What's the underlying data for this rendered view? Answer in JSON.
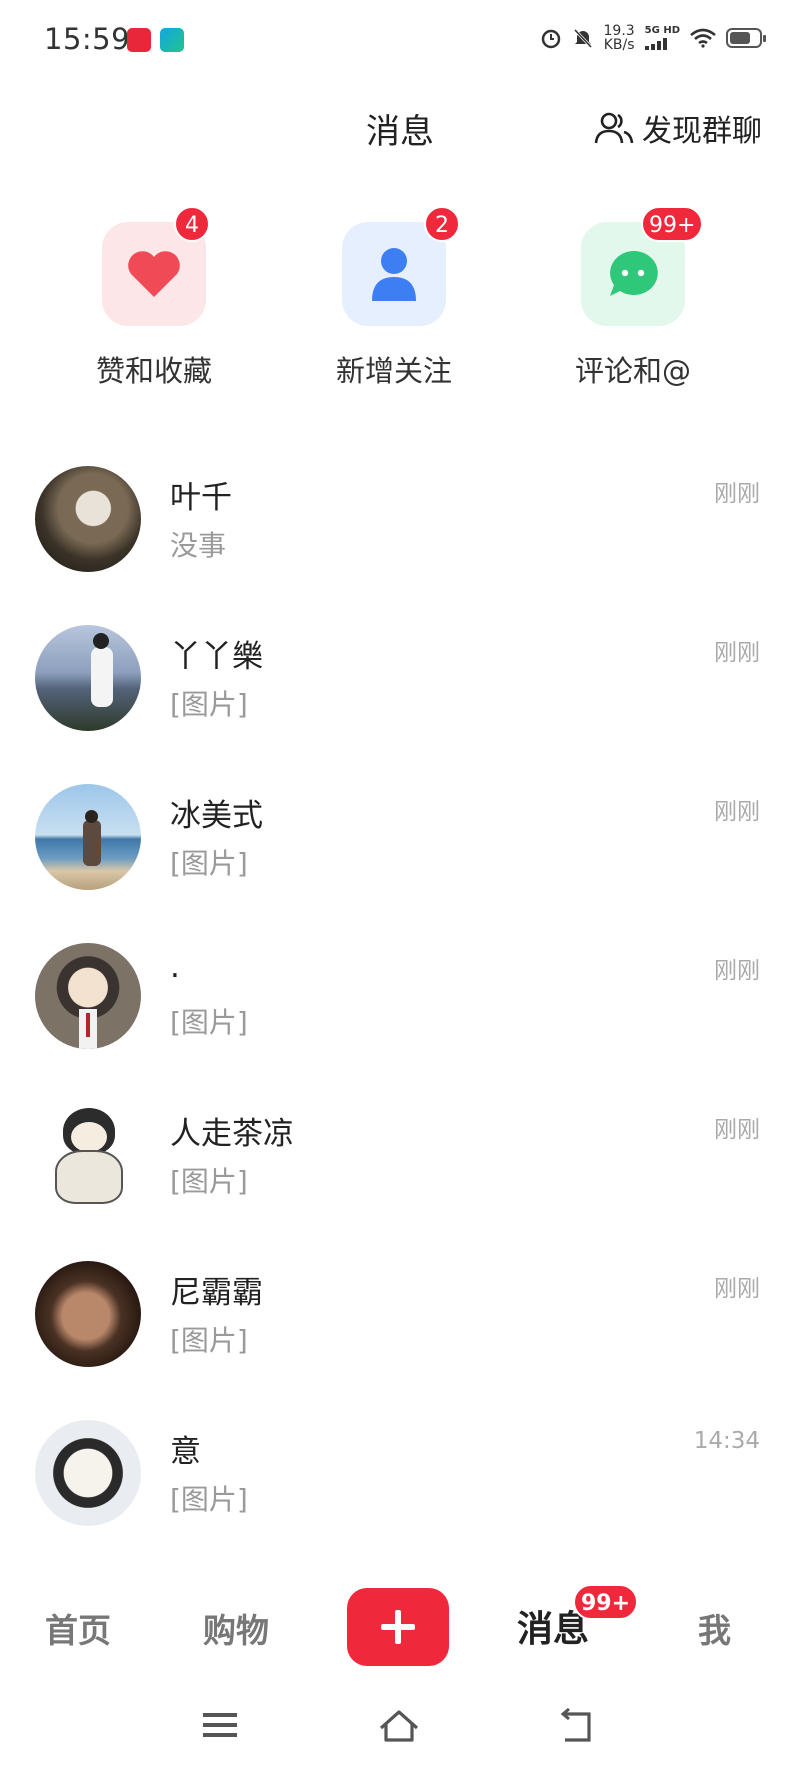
{
  "status_bar": {
    "time": "15:59",
    "net_speed_value": "19.3",
    "net_speed_unit": "KB/s",
    "signal_label": "5G HD",
    "battery_level": 0.7,
    "icons": [
      "xiaohongshu-app-icon",
      "wifi-hotspot-app-icon",
      "alarm-icon",
      "mute-icon",
      "signal-icon",
      "wifi-icon",
      "battery-icon"
    ]
  },
  "header": {
    "title": "消息",
    "discover_label": "发现群聊"
  },
  "shortcuts": [
    {
      "label": "赞和收藏",
      "badge": "4",
      "icon": "heart-icon",
      "color": "#f04a57"
    },
    {
      "label": "新增关注",
      "badge": "2",
      "icon": "user-icon",
      "color": "#3d7ff2"
    },
    {
      "label": "评论和@",
      "badge": "99+",
      "icon": "chat-bubble-icon",
      "color": "#2fc77a"
    }
  ],
  "messages": [
    {
      "name": "叶千",
      "preview": "没事",
      "time": "刚刚"
    },
    {
      "name": "丫丫樂",
      "preview": "[图片]",
      "time": "刚刚"
    },
    {
      "name": "冰美式",
      "preview": "[图片]",
      "time": "刚刚"
    },
    {
      "name": ".",
      "preview": "[图片]",
      "time": "刚刚"
    },
    {
      "name": "人走茶凉",
      "preview": "[图片]",
      "time": "刚刚"
    },
    {
      "name": "尼霸霸",
      "preview": "[图片]",
      "time": "刚刚"
    },
    {
      "name": "意",
      "preview": "[图片]",
      "time": "14:34"
    }
  ],
  "tabbar": {
    "home": "首页",
    "shop": "购物",
    "messages": "消息",
    "messages_badge": "99+",
    "me": "我",
    "accent": "#f0283c"
  }
}
